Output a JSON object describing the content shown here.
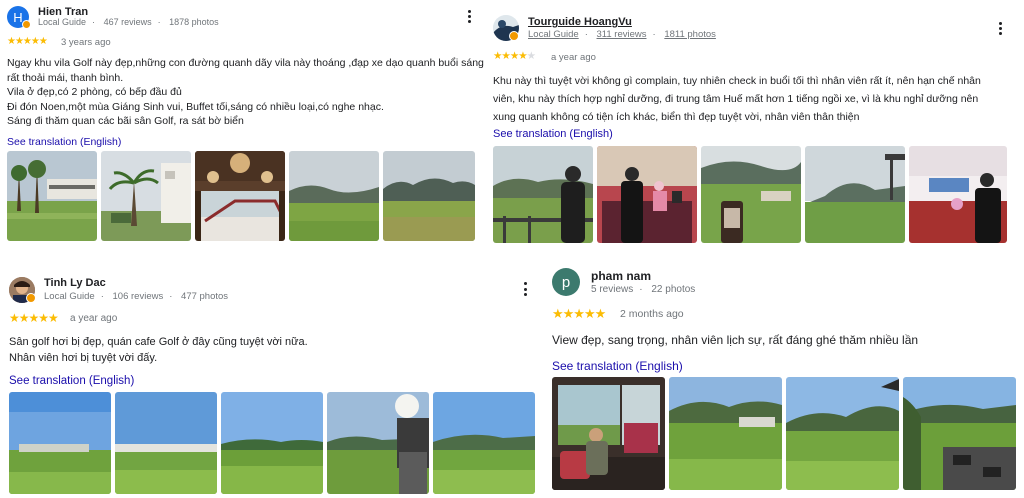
{
  "reviews": [
    {
      "author": "Hien Tran",
      "avatar_letter": "H",
      "avatar_color": "#1a73e8",
      "local_guide": "Local Guide",
      "reviews_count": "467 reviews",
      "photos_count": "1878 photos",
      "rating": 5,
      "date": "3 years ago",
      "text_lines": [
        "Ngay khu vila Golf này đẹp,những con đường quanh dãy vila này thoáng ,đạp xe dạo quanh buổi sáng",
        "rất thoải mái, thanh bình.",
        "Vila ở đẹp,có 2 phòng, có bếp đầu đủ",
        "Đi đón Noen,một mùa Giáng Sinh vui, Buffet tối,sáng có nhiều loại,có nghe nhạc.",
        "Sáng đi thăm quan các bãi sân Golf, ra sát bờ biển"
      ],
      "translate_label": "See translation (English)",
      "photo_count_shown": 5
    },
    {
      "author": "Tourguide HoangVu",
      "local_guide": "Local Guide",
      "reviews_count": "311 reviews",
      "photos_count": "1811 photos",
      "rating": 4,
      "date": "a year ago",
      "text_lines": [
        "Khu này thì tuyệt vời không gì complain, tuy nhiên check in buổi tối thì nhân viên rất ít, nên hạn chế nhân",
        "viên, khu này thích hợp nghỉ dưỡng, đi trung tâm Huế mất hơn 1 tiếng ngồi xe, vì là khu nghỉ dưỡng nên",
        "xung quanh không có tiện ích khác, biển thì đẹp tuyệt vời, nhân viên thân thiện"
      ],
      "translate_label": "See translation (English)",
      "photo_count_shown": 5
    },
    {
      "author": "Tinh Ly Dac",
      "local_guide": "Local Guide",
      "reviews_count": "106 reviews",
      "photos_count": "477 photos",
      "rating": 5,
      "date": "a year ago",
      "text_lines": [
        "Sân golf hơi bị đẹp, quán cafe Golf ở đây cũng tuyệt vời nữa.",
        "Nhân viên hơi bị tuyệt vời đấy."
      ],
      "translate_label": "See translation (English)",
      "photo_count_shown": 5
    },
    {
      "author": "pham nam",
      "avatar_letter": "p",
      "avatar_color": "#3c7a6e",
      "reviews_count": "5 reviews",
      "photos_count": "22 photos",
      "rating": 5,
      "date": "2 months ago",
      "text_lines": [
        "View đẹp, sang trọng, nhân viên lịch sự, rất đáng ghé thăm nhiều lần"
      ],
      "translate_label": "See translation (English)",
      "photo_count_shown": 4
    }
  ],
  "colors": {
    "star": "#fbbc04",
    "link": "#1a0dab",
    "meta": "#70757a",
    "badge": "#f29900"
  },
  "icons": {
    "more": "more-vert-icon",
    "star": "star-icon",
    "local_guide_badge": "local-guide-badge-icon"
  }
}
